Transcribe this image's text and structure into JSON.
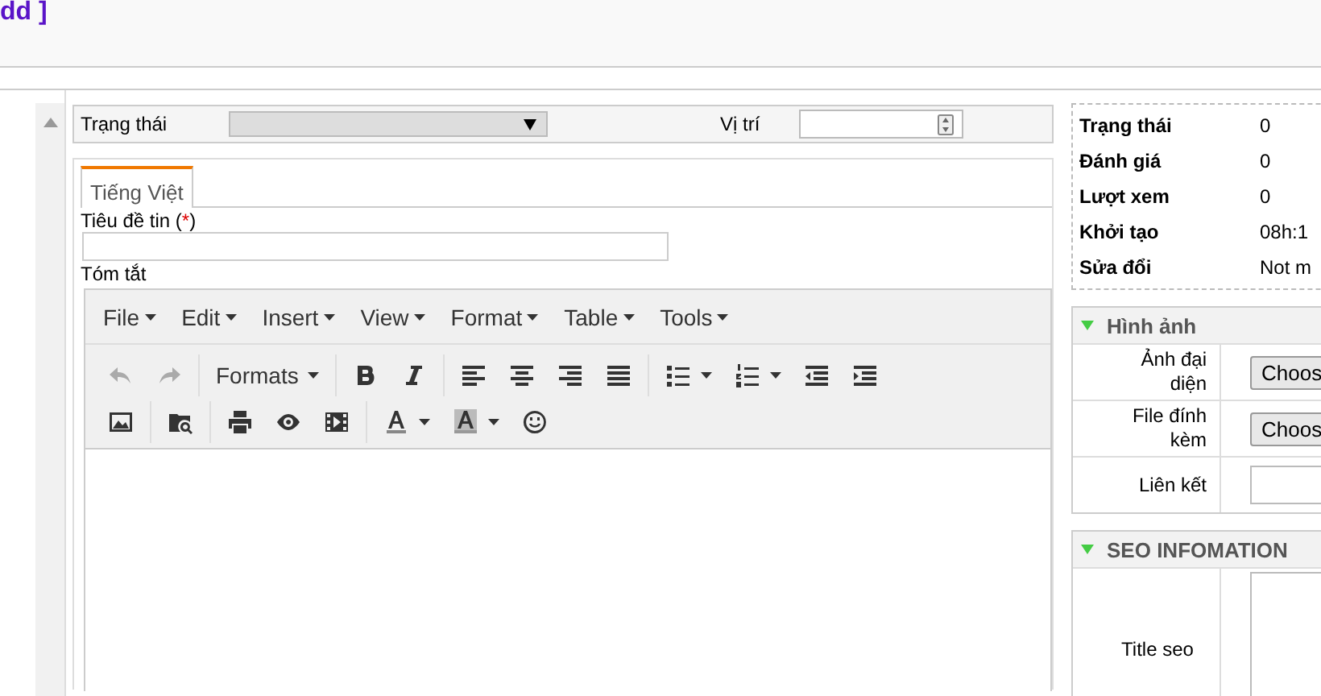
{
  "header": {
    "title": "dd ]"
  },
  "filter": {
    "status_label": "Trạng thái",
    "position_label": "Vị trí"
  },
  "tabs": [
    {
      "label": "Tiếng Việt",
      "selected": true
    }
  ],
  "form": {
    "title_label": "Tiêu đề tin (",
    "required_mark": "*",
    "title_label_end": ")",
    "summary_label": "Tóm tắt"
  },
  "editor": {
    "menus": [
      "File",
      "Edit",
      "Insert",
      "View",
      "Format",
      "Table",
      "Tools"
    ],
    "toolbar_rows": [
      [
        [
          {
            "kind": "undo",
            "disabled": true
          },
          {
            "kind": "redo",
            "disabled": true
          }
        ],
        [
          {
            "kind": "formats",
            "label": "Formats",
            "disabled": false
          }
        ],
        [
          {
            "kind": "bold",
            "disabled": false
          },
          {
            "kind": "italic",
            "disabled": false
          }
        ],
        [
          {
            "kind": "align-left",
            "disabled": false
          },
          {
            "kind": "align-center",
            "disabled": false
          },
          {
            "kind": "align-right",
            "disabled": false
          },
          {
            "kind": "justify",
            "disabled": false
          }
        ],
        [
          {
            "kind": "bullets",
            "disabled": false
          },
          {
            "kind": "numbers",
            "disabled": false
          },
          {
            "kind": "outdent",
            "disabled": false
          },
          {
            "kind": "indent",
            "disabled": false
          }
        ]
      ],
      [
        [
          {
            "kind": "image",
            "disabled": false
          }
        ],
        [
          {
            "kind": "find",
            "disabled": false
          }
        ],
        [
          {
            "kind": "print",
            "disabled": false
          },
          {
            "kind": "preview",
            "disabled": false
          },
          {
            "kind": "media",
            "disabled": false
          }
        ],
        [
          {
            "kind": "text-color",
            "disabled": false
          },
          {
            "kind": "back-color",
            "disabled": false
          },
          {
            "kind": "emoji",
            "disabled": false
          }
        ]
      ]
    ]
  },
  "info": [
    {
      "label": "Trạng thái",
      "value": "0"
    },
    {
      "label": "Đánh giá",
      "value": "0"
    },
    {
      "label": "Lượt xem",
      "value": "0"
    },
    {
      "label": "Khởi tạo",
      "value": "08h:1"
    },
    {
      "label": "Sửa đổi",
      "value": "Not m"
    }
  ],
  "sections": [
    {
      "title": "Hình ảnh",
      "expanded": true,
      "rows": [
        {
          "kind": "file",
          "label": "Ảnh đại diện",
          "button": "Choos"
        },
        {
          "kind": "file",
          "label": "File đính kèm",
          "button": "Choos"
        },
        {
          "kind": "input",
          "label": "Liên kết"
        }
      ]
    },
    {
      "title": "SEO INFOMATION",
      "expanded": true,
      "rows": [
        {
          "kind": "textarea",
          "label": "Title seo"
        }
      ]
    }
  ]
}
